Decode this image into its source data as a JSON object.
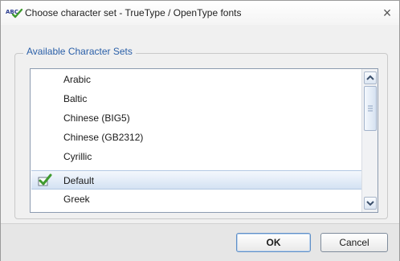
{
  "window": {
    "title": "Choose character set - TrueType / OpenType fonts",
    "app_icon": "abc-spellcheck-icon",
    "close_label": "×"
  },
  "group": {
    "label": "Available Character Sets"
  },
  "list": {
    "items": [
      {
        "label": "Arabic",
        "selected": false,
        "checked": false
      },
      {
        "label": "Baltic",
        "selected": false,
        "checked": false
      },
      {
        "label": "Chinese (BIG5)",
        "selected": false,
        "checked": false
      },
      {
        "label": "Chinese (GB2312)",
        "selected": false,
        "checked": false
      },
      {
        "label": "Cyrillic",
        "selected": false,
        "checked": false
      },
      {
        "label": "Default",
        "selected": true,
        "checked": true
      },
      {
        "label": "Greek",
        "selected": false,
        "checked": false
      }
    ],
    "check_icon": "green-checkmark-icon"
  },
  "buttons": {
    "ok_label": "OK",
    "cancel_label": "Cancel"
  },
  "colors": {
    "group_label": "#2a5fa8",
    "selection": "#d4e2f3",
    "check_green": "#3f9a2e"
  }
}
